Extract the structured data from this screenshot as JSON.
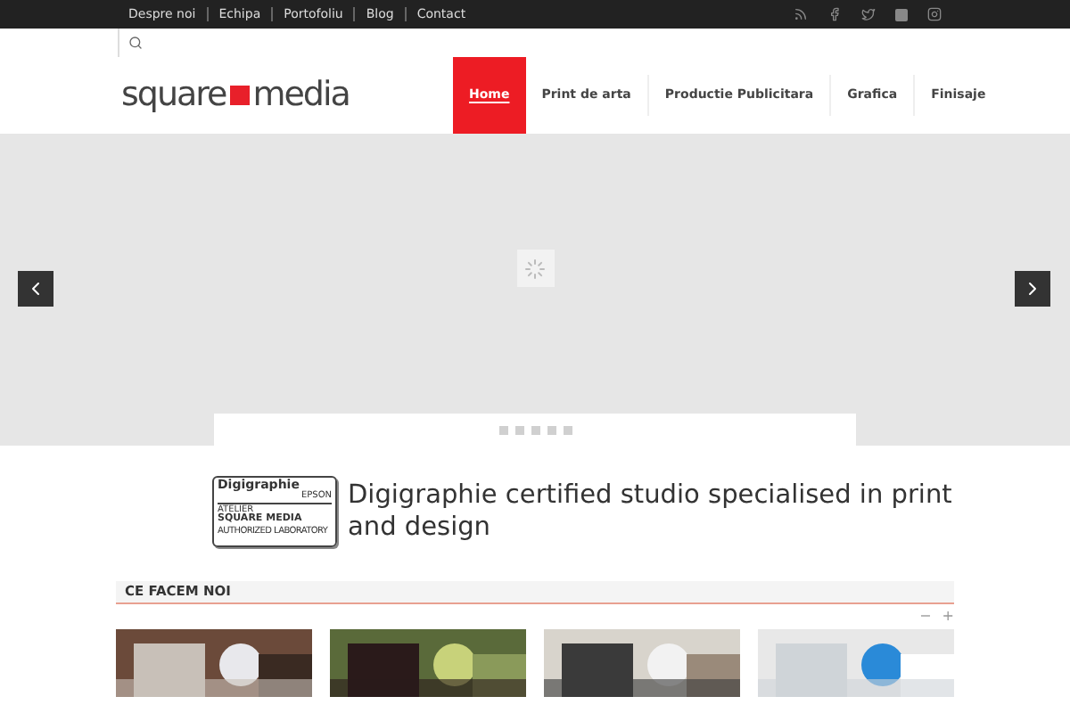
{
  "top_bar": {
    "links": [
      "Despre noi",
      "Echipa",
      "Portofoliu",
      "Blog",
      "Contact"
    ]
  },
  "logo": {
    "left": "square",
    "right": "media"
  },
  "nav": [
    {
      "label": "Home",
      "selected": true
    },
    {
      "label": "Print de arta",
      "selected": false
    },
    {
      "label": "Productie Publicitara",
      "selected": false
    },
    {
      "label": "Grafica",
      "selected": false
    },
    {
      "label": "Finisaje",
      "selected": false
    }
  ],
  "slider": {
    "dots": [
      {
        "selected": false
      },
      {
        "selected": false
      },
      {
        "selected": false
      },
      {
        "selected": false
      },
      {
        "selected": false
      }
    ]
  },
  "badge": {
    "brand": "Digigraphie",
    "maker": "EPSON",
    "line1": "ATELIER",
    "line2": "SQUARE MEDIA",
    "line3": "AUTHORIZED LABORATORY"
  },
  "headline": "Digigraphie certified studio specialised in print and design",
  "section": {
    "title": "CE FACEM NOI",
    "collapse": "−",
    "expand": "+"
  }
}
